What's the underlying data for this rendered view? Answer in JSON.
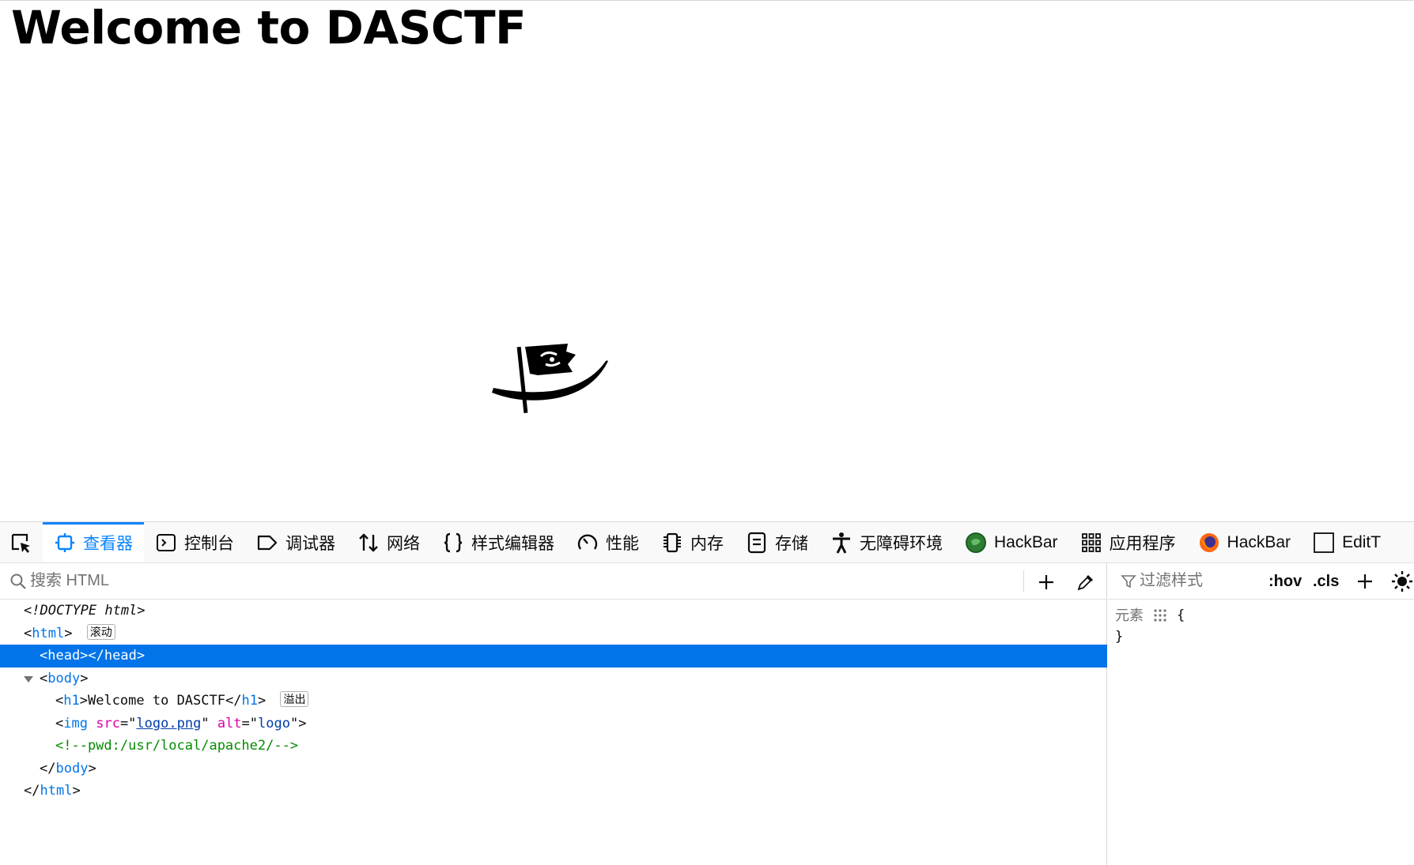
{
  "page": {
    "heading": "Welcome to DASCTF"
  },
  "devtools": {
    "tabs": [
      {
        "label": "查看器",
        "icon": "inspector-icon"
      },
      {
        "label": "控制台",
        "icon": "console-icon"
      },
      {
        "label": "调试器",
        "icon": "debugger-icon"
      },
      {
        "label": "网络",
        "icon": "network-icon"
      },
      {
        "label": "样式编辑器",
        "icon": "style-editor-icon"
      },
      {
        "label": "性能",
        "icon": "performance-icon"
      },
      {
        "label": "内存",
        "icon": "memory-icon"
      },
      {
        "label": "存储",
        "icon": "storage-icon"
      },
      {
        "label": "无障碍环境",
        "icon": "accessibility-icon"
      },
      {
        "label": "HackBar",
        "icon": "hackbar-green-icon"
      },
      {
        "label": "应用程序",
        "icon": "application-icon"
      },
      {
        "label": "HackBar",
        "icon": "firefox-hackbar-icon"
      },
      {
        "label": "EditT",
        "icon": "edit-icon"
      }
    ],
    "search_placeholder": "搜索 HTML",
    "markup": {
      "doctype": "<!DOCTYPE html>",
      "html_open_lt": "<",
      "html_tag": "html",
      "gt": ">",
      "scroll_badge": "滚动",
      "head_line": "<head></head>",
      "body_tag": "body",
      "h1_tag": "h1",
      "h1_text": "Welcome to DASCTF",
      "overflow_badge": "溢出",
      "img_tag": "img",
      "src_attr": "src",
      "src_val": "logo.png",
      "alt_attr": "alt",
      "alt_val": "logo",
      "comment": "<!--pwd:/usr/local/apache2/-->",
      "close_lt": "</",
      "eq_quote": "=\"",
      "quote": "\"",
      "lt": "<"
    },
    "rules": {
      "filter_placeholder": "过滤样式",
      "hov": ":hov",
      "cls": ".cls",
      "element_label": "元素",
      "open_brace": "{",
      "close_brace": "}"
    }
  }
}
